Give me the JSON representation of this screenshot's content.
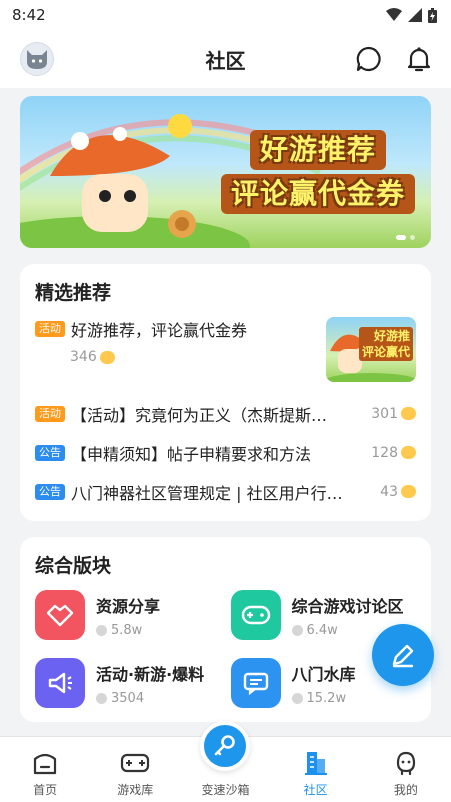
{
  "status_bar": {
    "time": "8:42"
  },
  "header": {
    "title": "社区"
  },
  "featured": {
    "title": "精选推荐",
    "top_item": {
      "tag": "活动",
      "title": "好游推荐，评论赢代金券",
      "count": "346"
    },
    "items": [
      {
        "tag": "活动",
        "tag_color": "#ff9a1b",
        "title": "【活动】究竟何为正义（杰斯提斯…",
        "count": "301"
      },
      {
        "tag": "公告",
        "tag_color": "#2d8cf0",
        "title": "【申精须知】帖子申精要求和方法",
        "count": "128"
      },
      {
        "tag": "公告",
        "tag_color": "#2d8cf0",
        "title": "八门神器社区管理规定 | 社区用户行…",
        "count": "43"
      }
    ]
  },
  "boards": {
    "title": "综合版块",
    "items": [
      {
        "name": "资源分享",
        "count": "5.8w",
        "icon": "handshake-icon",
        "color": "#f2555f"
      },
      {
        "name": "综合游戏讨论区",
        "count": "6.4w",
        "icon": "gamepad-icon",
        "color": "#20c8a0"
      },
      {
        "name": "活动·新游·爆料",
        "count": "3504",
        "icon": "megaphone-icon",
        "color": "#6b62f2"
      },
      {
        "name": "八门水库",
        "count": "15.2w",
        "icon": "chat-icon",
        "color": "#2c93f0"
      }
    ]
  },
  "tabbar": {
    "items": [
      {
        "label": "首页",
        "icon": "home-icon"
      },
      {
        "label": "游戏库",
        "icon": "game-controller-icon"
      },
      {
        "label": "变速沙箱",
        "icon": "key-icon"
      },
      {
        "label": "社区",
        "icon": "community-building-icon",
        "active": true
      },
      {
        "label": "我的",
        "icon": "profile-icon"
      }
    ]
  },
  "colors": {
    "accent": "#1e96ec",
    "orange_tag": "#ff9a1b",
    "blue_tag": "#2d8cf0"
  }
}
